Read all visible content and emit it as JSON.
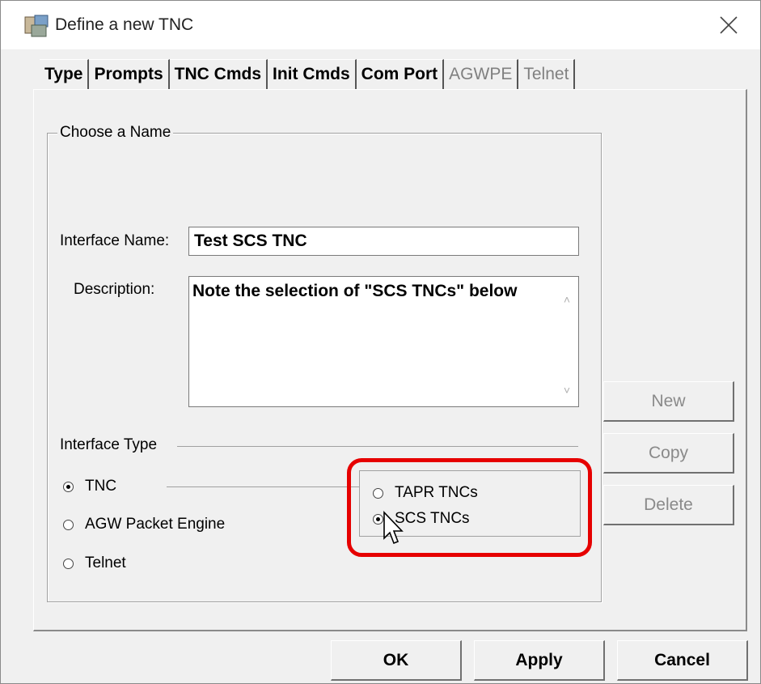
{
  "window": {
    "title": "Define a new TNC",
    "icon": "tnc-app-icon",
    "close_icon": "close-x-icon"
  },
  "tabs": [
    {
      "label": "Type",
      "state": "active"
    },
    {
      "label": "Prompts",
      "state": "normal"
    },
    {
      "label": "TNC Cmds",
      "state": "normal"
    },
    {
      "label": "Init Cmds",
      "state": "normal"
    },
    {
      "label": "Com Port",
      "state": "normal"
    },
    {
      "label": "AGWPE",
      "state": "disabled"
    },
    {
      "label": "Telnet",
      "state": "disabled"
    }
  ],
  "group": {
    "legend": "Choose a Name",
    "interface_name_label": "Interface Name:",
    "interface_name_value": "Test SCS TNC",
    "description_label": "Description:",
    "description_value": "Note the selection of \"SCS TNCs\" below",
    "interface_type_label": "Interface Type",
    "interface_types": [
      {
        "label": "TNC",
        "checked": true
      },
      {
        "label": "AGW Packet Engine",
        "checked": false
      },
      {
        "label": "Telnet",
        "checked": false
      }
    ],
    "tnc_kinds": [
      {
        "label": "TAPR TNCs",
        "checked": false
      },
      {
        "label": "SCS TNCs",
        "checked": true
      }
    ],
    "highlight_color": "#e60000"
  },
  "side_buttons": {
    "new": "New",
    "copy": "Copy",
    "delete": "Delete"
  },
  "footer": {
    "ok": "OK",
    "apply": "Apply",
    "cancel": "Cancel"
  }
}
